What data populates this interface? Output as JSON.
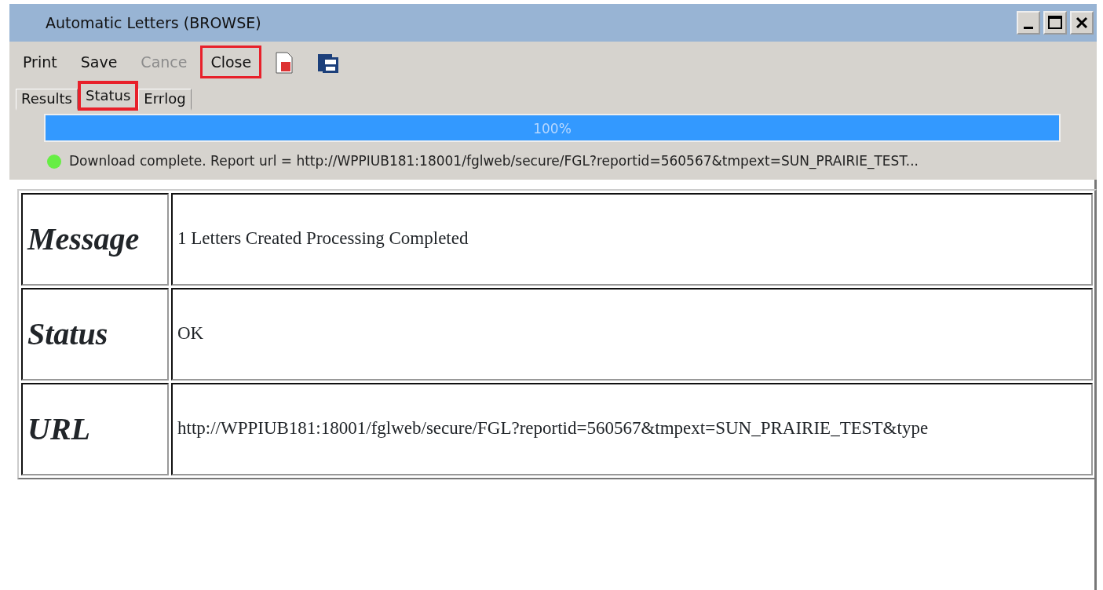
{
  "window": {
    "title": "Automatic Letters (BROWSE)"
  },
  "toolbar": [
    {
      "kind": "text",
      "label": "Print",
      "disabled": false,
      "highlighted": false
    },
    {
      "kind": "text",
      "label": "Save",
      "disabled": false,
      "highlighted": false
    },
    {
      "kind": "text",
      "label": "Cance",
      "disabled": true,
      "highlighted": false
    },
    {
      "kind": "text",
      "label": "Close",
      "disabled": false,
      "highlighted": true
    },
    {
      "kind": "pdf",
      "highlighted": false
    },
    {
      "kind": "clipboard",
      "highlighted": false
    }
  ],
  "tabs": [
    {
      "label": "Results",
      "selected": false,
      "highlighted": false
    },
    {
      "label": "Status",
      "selected": true,
      "highlighted": true
    },
    {
      "label": "Errlog",
      "selected": false,
      "highlighted": false
    }
  ],
  "progress": {
    "level": 1,
    "reading": "100%"
  },
  "status_line": {
    "color": "#66ee44",
    "text": "Download complete. Report url = http://WPPIUB181:18001/fglweb/secure/FGL?reportid=560567&tmpext=SUN_PRAIRIE_TEST..."
  },
  "table": {
    "rows": [
      {
        "label": "Message",
        "value": "1 Letters Created Processing Completed"
      },
      {
        "label": "Status",
        "value": "OK"
      },
      {
        "label": "URL",
        "value": "http://WPPIUB181:18001/fglweb/secure/FGL?reportid=560567&tmpext=SUN_PRAIRIE_TEST&type"
      }
    ]
  }
}
